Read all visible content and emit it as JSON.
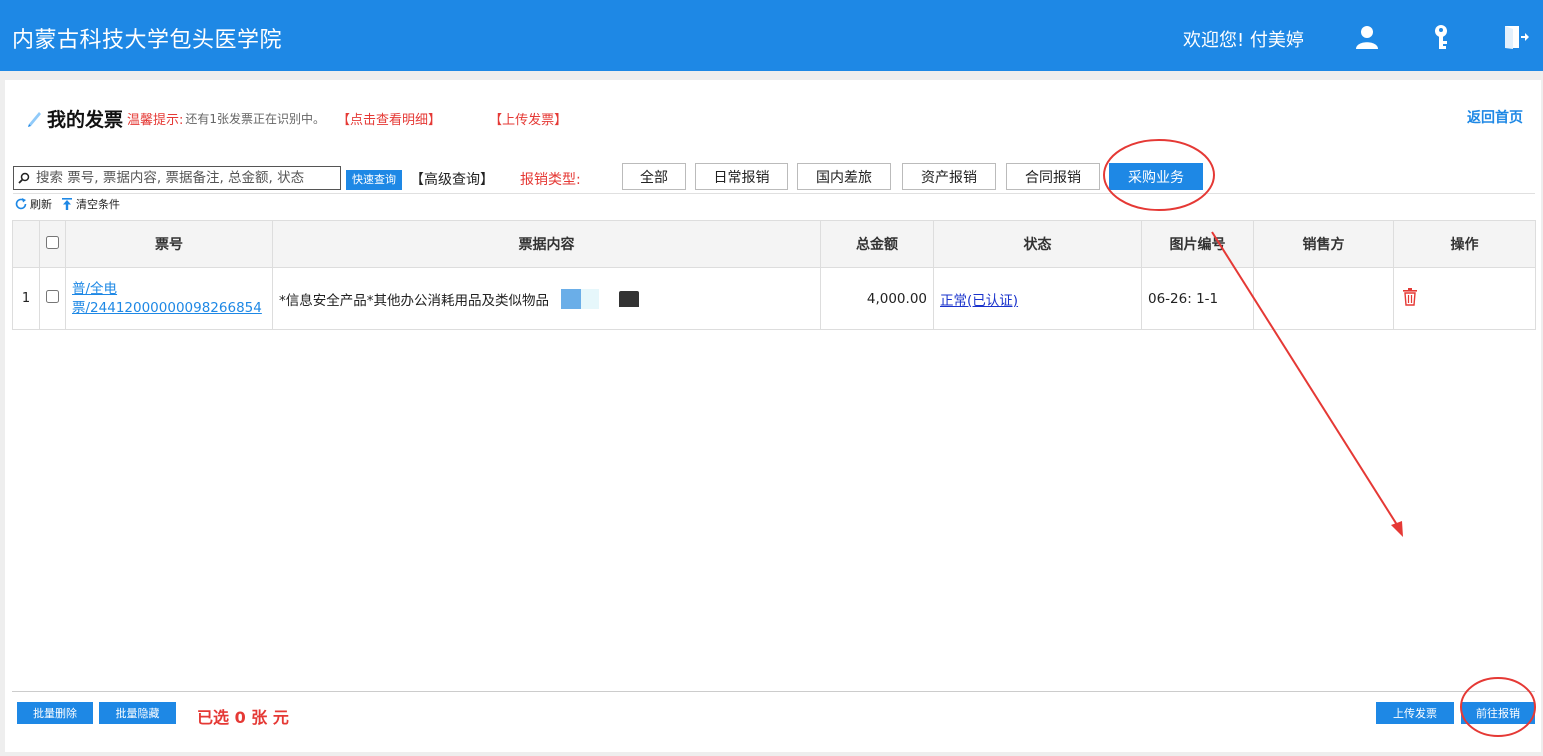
{
  "header": {
    "brand": "内蒙古科技大学包头医学院",
    "welcome": "欢迎您!  付美婷",
    "icons": [
      "user-icon",
      "key-icon",
      "logout-icon"
    ]
  },
  "page": {
    "title": "我的发票",
    "tip_label": "温馨提示:",
    "tip_text": "还有1张发票正在识别中。",
    "view_detail": "【点击查看明细】",
    "upload_link": "【上传发票】",
    "back_home": "返回首页"
  },
  "filters": {
    "search_placeholder": "搜索 票号, 票据内容, 票据备注, 总金额, 状态",
    "quick_query": "快速查询",
    "advanced_query": "【高级查询】",
    "type_label": "报销类型:",
    "types": [
      {
        "label": "全部",
        "active": false
      },
      {
        "label": "日常报销",
        "active": false
      },
      {
        "label": "国内差旅",
        "active": false
      },
      {
        "label": "资产报销",
        "active": false
      },
      {
        "label": "合同报销",
        "active": false
      },
      {
        "label": "采购业务",
        "active": true
      }
    ]
  },
  "toolbar": {
    "refresh": "刷新",
    "clear": "清空条件"
  },
  "table": {
    "columns": [
      "票号",
      "票据内容",
      "总金额",
      "状态",
      "图片编号",
      "销售方",
      "操作"
    ],
    "rows": [
      {
        "index": "1",
        "invoice_line1": "普/全电",
        "invoice_line2": "票/24412000000098266854",
        "content": "*信息安全产品*其他办公消耗用品及类似物品",
        "amount": "4,000.00",
        "status": "正常(已认证)",
        "image_no": "06-26: 1-1",
        "seller": ""
      }
    ]
  },
  "footer": {
    "batch_delete": "批量删除",
    "batch_hide": "批量隐藏",
    "selected": "已选 0 张 元",
    "upload": "上传发票",
    "goto_reimburse": "前往报销"
  },
  "colors": {
    "primary": "#1e88e5",
    "accent_red": "#e53935"
  }
}
